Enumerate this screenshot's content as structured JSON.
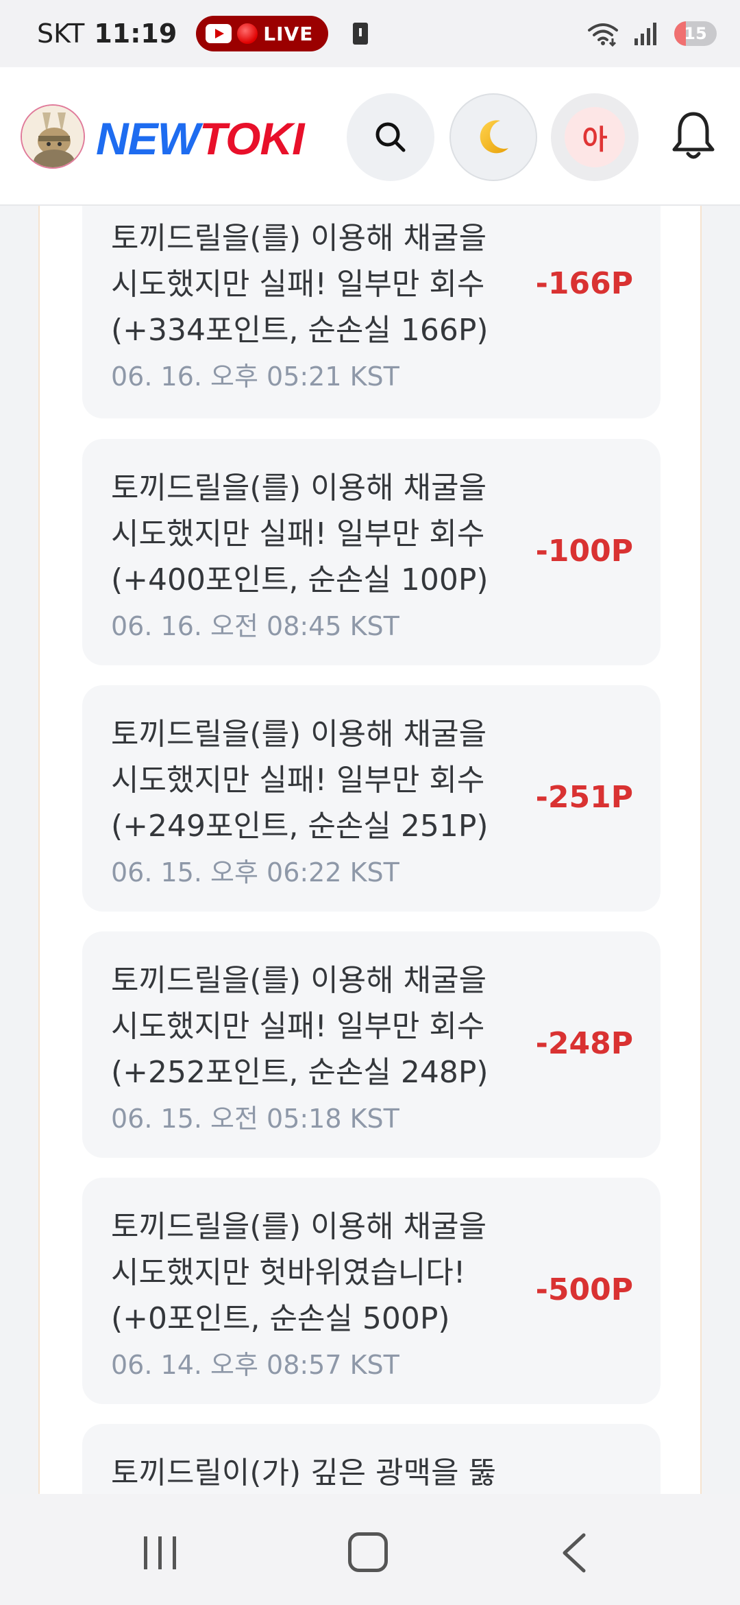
{
  "status_bar": {
    "carrier": "SKT",
    "time": "11:19",
    "live_label": "LIVE",
    "battery_level": "15",
    "icons": [
      "youtube-icon",
      "record-dot-icon",
      "clipboard-icon",
      "wifi-icon",
      "signal-icon",
      "battery-icon"
    ]
  },
  "header": {
    "brand_part1": "NEW",
    "brand_part2": "TOKI",
    "user_initial": "아",
    "icons": [
      "search-icon",
      "moon-icon",
      "bell-icon"
    ],
    "colors": {
      "brand_blue": "#1e6cf0",
      "brand_red": "#e8102a"
    }
  },
  "history": {
    "items": [
      {
        "line1": "토끼드릴을(를) 이용해 채굴을",
        "line2": "시도했지만 실패! 일부만 회수",
        "line3": "(+334포인트, 순손실 166P)",
        "date": "06. 16. 오후 05:21 KST",
        "amount": "-166P"
      },
      {
        "line1": "토끼드릴을(를) 이용해 채굴을",
        "line2": "시도했지만 실패! 일부만 회수",
        "line3": "(+400포인트, 순손실 100P)",
        "date": "06. 16. 오전 08:45 KST",
        "amount": "-100P"
      },
      {
        "line1": "토끼드릴을(를) 이용해 채굴을",
        "line2": "시도했지만 실패! 일부만 회수",
        "line3": "(+249포인트, 순손실 251P)",
        "date": "06. 15. 오후 06:22 KST",
        "amount": "-251P"
      },
      {
        "line1": "토끼드릴을(를) 이용해 채굴을",
        "line2": "시도했지만 실패! 일부만 회수",
        "line3": "(+252포인트, 순손실 248P)",
        "date": "06. 15. 오전 05:18 KST",
        "amount": "-248P"
      },
      {
        "line1": "토끼드릴을(를) 이용해 채굴을",
        "line2": "시도했지만 헛바위였습니다!",
        "line3": "(+0포인트, 순손실 500P)",
        "date": "06. 14. 오후 08:57 KST",
        "amount": "-500P"
      },
      {
        "line1": "토끼드릴이(가) 깊은 광맥을 뚫"
      }
    ],
    "colors": {
      "negative_amount": "#d93232"
    }
  },
  "nav_bar": {
    "icons": [
      "recents-icon",
      "home-icon",
      "back-icon"
    ]
  }
}
